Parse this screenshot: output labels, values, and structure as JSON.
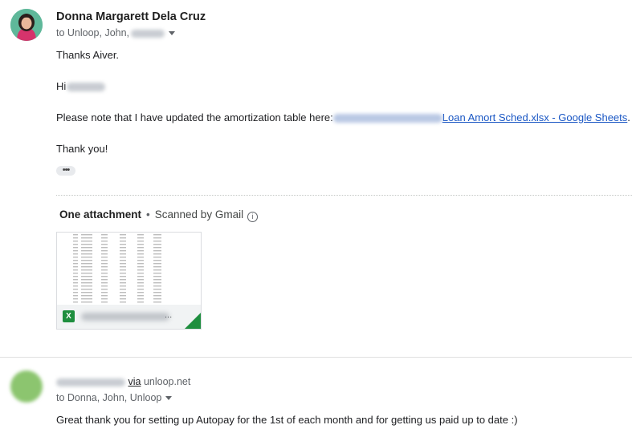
{
  "message1": {
    "sender_name": "Donna Margarett Dela Cruz",
    "recipients_prefix": "to Unloop, John,",
    "body": {
      "greeting": "Thanks Aiver.",
      "hi": "Hi",
      "note_prefix": "Please note that I have updated the amortization table here:",
      "link_text": "Loan Amort Sched.xlsx - Google Sheets",
      "note_suffix": ".",
      "closing": "Thank you!"
    },
    "more_label": "•••",
    "attachment": {
      "count_label": "One attachment",
      "separator": "•",
      "scan_label": "Scanned by Gmail",
      "info_icon": "info-icon",
      "file_icon": "X",
      "file_ellipsis": "..."
    }
  },
  "message2": {
    "via_label": "via",
    "via_domain": "unloop.net",
    "recipients": "to Donna, John, Unloop",
    "body": "Great thank you for setting up Autopay for the 1st of each month and for getting us paid up to date :)"
  },
  "colors": {
    "link": "#1a57c4",
    "sheets_green": "#1e8e3e",
    "avatar1_bg": "#5fb89a",
    "avatar2_bg": "#8cc56f"
  }
}
